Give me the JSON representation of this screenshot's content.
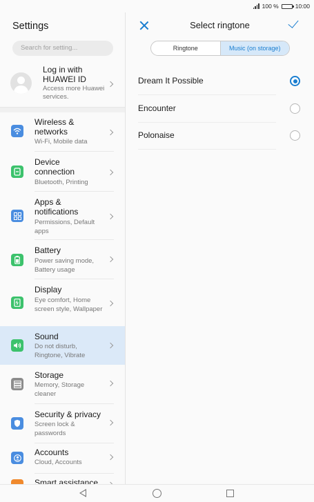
{
  "status_bar": {
    "battery_text": "100 %",
    "time": "10:00"
  },
  "left": {
    "title": "Settings",
    "search_placeholder": "Search for setting...",
    "account": {
      "line1": "Log in with",
      "line2": "HUAWEI ID",
      "sub": "Access more Huawei services."
    },
    "menu": [
      {
        "title": "Wireless & networks",
        "desc": "Wi-Fi, Mobile data",
        "icon": "wifi-icon",
        "color": "#4a8de0"
      },
      {
        "title": "Device connection",
        "desc": "Bluetooth, Printing",
        "icon": "device-connection-icon",
        "color": "#3cc26c"
      },
      {
        "title": "Apps & notifications",
        "desc": "Permissions, Default apps",
        "icon": "apps-icon",
        "color": "#4a8de0"
      },
      {
        "title": "Battery",
        "desc": "Power saving mode, Battery usage",
        "icon": "battery-icon",
        "color": "#3cc26c"
      },
      {
        "title": "Display",
        "desc": "Eye comfort, Home screen style, Wallpaper",
        "icon": "display-icon",
        "color": "#3cc26c"
      },
      {
        "title": "Sound",
        "desc": "Do not disturb, Ringtone, Vibrate",
        "icon": "sound-icon",
        "color": "#3cc26c",
        "active": true
      },
      {
        "title": "Storage",
        "desc": "Memory, Storage cleaner",
        "icon": "storage-icon",
        "color": "#8c8c8c"
      },
      {
        "title": "Security & privacy",
        "desc": "Screen lock & passwords",
        "icon": "shield-icon",
        "color": "#4a8de0"
      },
      {
        "title": "Accounts",
        "desc": "Cloud, Accounts",
        "icon": "accounts-icon",
        "color": "#4a8de0"
      },
      {
        "title": "Smart assistance",
        "desc": "",
        "icon": "smart-assistance-icon",
        "color": "#f0892c"
      }
    ]
  },
  "right": {
    "title": "Select ringtone",
    "tabs": [
      "Ringtone",
      "Music (on storage)"
    ],
    "selected_tab": "Music (on storage)",
    "ringtones": [
      {
        "name": "Dream It Possible",
        "selected": true
      },
      {
        "name": "Encounter",
        "selected": false
      },
      {
        "name": "Polonaise",
        "selected": false
      }
    ]
  },
  "accent_color": "#1a7ed0"
}
